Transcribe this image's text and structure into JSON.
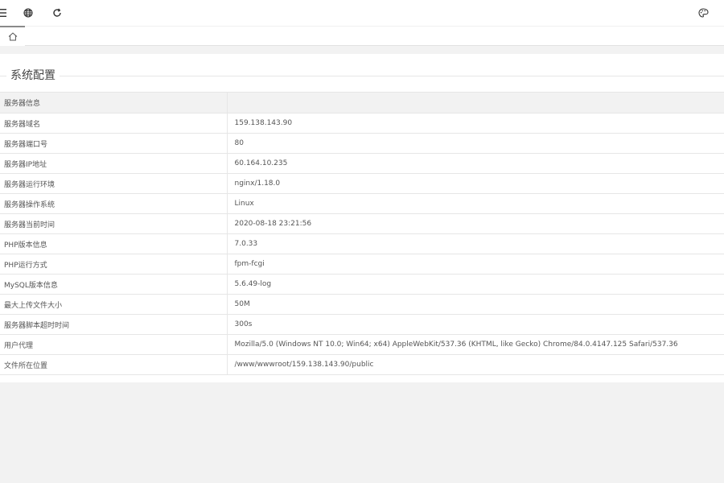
{
  "header": {
    "icons": [
      "menu-icon",
      "globe-icon",
      "refresh-icon",
      "palette-icon"
    ]
  },
  "tabs": {
    "home_icon": "home-icon"
  },
  "section": {
    "title": "系统配置"
  },
  "table": {
    "header_label": "服务器信息",
    "header_value": "",
    "rows": [
      {
        "label": "服务器域名",
        "value": "159.138.143.90"
      },
      {
        "label": "服务器端口号",
        "value": "80"
      },
      {
        "label": "服务器IP地址",
        "value": "60.164.10.235"
      },
      {
        "label": "服务器运行环境",
        "value": "nginx/1.18.0"
      },
      {
        "label": "服务器操作系统",
        "value": "Linux"
      },
      {
        "label": "服务器当前时间",
        "value": "2020-08-18 23:21:56"
      },
      {
        "label": "PHP版本信息",
        "value": "7.0.33"
      },
      {
        "label": "PHP运行方式",
        "value": "fpm-fcgi"
      },
      {
        "label": "MySQL版本信息",
        "value": "5.6.49-log"
      },
      {
        "label": "最大上传文件大小",
        "value": "50M"
      },
      {
        "label": "服务器脚本超时时间",
        "value": "300s"
      },
      {
        "label": "用户代理",
        "value": "Mozilla/5.0 (Windows NT 10.0; Win64; x64) AppleWebKit/537.36 (KHTML, like Gecko) Chrome/84.0.4147.125 Safari/537.36"
      },
      {
        "label": "文件所在位置",
        "value": "/www/wwwroot/159.138.143.90/public"
      }
    ]
  },
  "colors": {
    "page_bg": "#f2f2f2",
    "card_bg": "#ffffff",
    "border": "#e6e6e6",
    "text": "#555555"
  }
}
